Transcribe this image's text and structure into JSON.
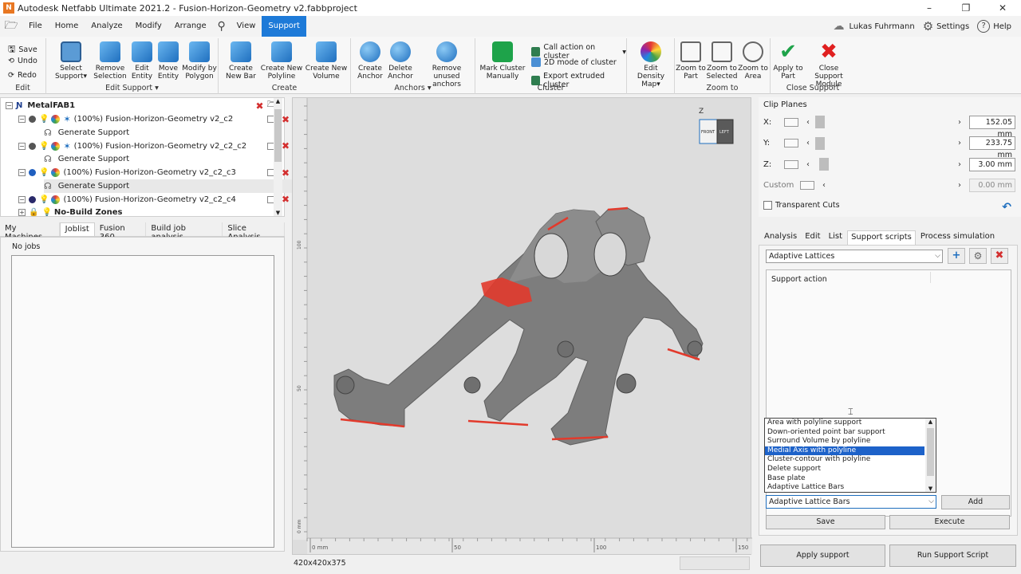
{
  "window": {
    "title": "Autodesk Netfabb Ultimate 2021.2 - Fusion-Horizon-Geometry v2.fabbproject",
    "minimize": "–",
    "restore": "❐",
    "close": "✕"
  },
  "menu": {
    "items": [
      "File",
      "Home",
      "Analyze",
      "Modify",
      "Arrange",
      "View",
      "Support"
    ],
    "active": "Support",
    "user": "Lukas Fuhrmann",
    "settings": "Settings",
    "help": "Help"
  },
  "ribbon": {
    "quick": {
      "save": "Save",
      "undo": "Undo",
      "redo": "Redo",
      "group": "Edit"
    },
    "edit_support": {
      "group": "Edit Support ▾",
      "buttons": [
        "Select Support▾",
        "Remove Selection",
        "Edit Entity",
        "Move Entity",
        "Modify by Polygon"
      ]
    },
    "create": {
      "group": "Create",
      "buttons": [
        "Create New Bar",
        "Create New Polyline",
        "Create New Volume"
      ]
    },
    "anchors": {
      "group": "Anchors ▾",
      "buttons": [
        "Create Anchor",
        "Delete Anchor",
        "Remove unused anchors"
      ]
    },
    "cluster": {
      "group": "Cluster",
      "mark": "Mark Cluster Manually",
      "call_action": "Call action on cluster",
      "mode2d": "2D mode of cluster",
      "export": "Export extruded cluster"
    },
    "density": {
      "label": "Edit Density Map▾"
    },
    "zoom": {
      "group": "Zoom to",
      "buttons": [
        "Zoom to Part",
        "Zoom to Selected",
        "Zoom to Area"
      ]
    },
    "close_support": {
      "group": "Close Support",
      "apply": "Apply to Part",
      "close": "Close Support Module"
    }
  },
  "tree": {
    "root": "MetalFAB1",
    "rows": [
      {
        "label": "(100%) Fusion-Horizon-Geometry v2_c2",
        "type": "part",
        "dot": "#555555"
      },
      {
        "label": "Generate Support",
        "type": "support"
      },
      {
        "label": "(100%) Fusion-Horizon-Geometry v2_c2_c2",
        "type": "part",
        "dot": "#555555"
      },
      {
        "label": "Generate Support",
        "type": "support"
      },
      {
        "label": "(100%) Fusion-Horizon-Geometry v2_c2_c3",
        "type": "part",
        "dot": "#1f5fbf"
      },
      {
        "label": "Generate Support",
        "type": "support"
      },
      {
        "label": "(100%) Fusion-Horizon-Geometry v2_c2_c4",
        "type": "part",
        "dot": "#2a2a6a"
      }
    ],
    "zones": "No-Build Zones"
  },
  "left_tabs": [
    "My Machines",
    "Joblist",
    "Fusion 360",
    "Build job analysis",
    "Slice Analysis"
  ],
  "left_tab_active": "Joblist",
  "joblist": {
    "empty": "No jobs"
  },
  "viewport": {
    "axis_z": "Z",
    "cube_front": "FRONT",
    "cube_left": "LEFT",
    "ruler_bottom": [
      "0 mm",
      "50",
      "100",
      "150"
    ],
    "ruler_left": [
      "100",
      "50",
      "0 mm"
    ],
    "dims": "420x420x375"
  },
  "clip_planes": {
    "title": "Clip Planes",
    "rows": [
      {
        "label": "X:",
        "value": "152.05 mm",
        "knob": 0.02
      },
      {
        "label": "Y:",
        "value": "233.75 mm",
        "knob": 0.02
      },
      {
        "label": "Z:",
        "value": "3.00 mm",
        "knob": 0.05
      },
      {
        "label": "Custom",
        "value": "0.00 mm",
        "knob": null
      }
    ],
    "transparent": "Transparent Cuts"
  },
  "right_tabs": [
    "Analysis",
    "Edit",
    "List",
    "Support scripts",
    "Process simulation"
  ],
  "right_tab_active": "Support scripts",
  "scripts": {
    "selected": "Adaptive Lattices",
    "action_header": "Support action",
    "options": [
      "Area with polyline support",
      "Down-oriented point bar support",
      "Surround Volume by polyline",
      "Medial Axis with polyline",
      "Cluster-contour with polyline",
      "Delete support",
      "Base plate",
      "Adaptive Lattice Bars"
    ],
    "highlighted": "Medial Axis with polyline",
    "combo_value": "Adaptive Lattice Bars",
    "add": "Add",
    "save": "Save",
    "execute": "Execute",
    "apply_support": "Apply support",
    "run_script": "Run Support Script"
  }
}
